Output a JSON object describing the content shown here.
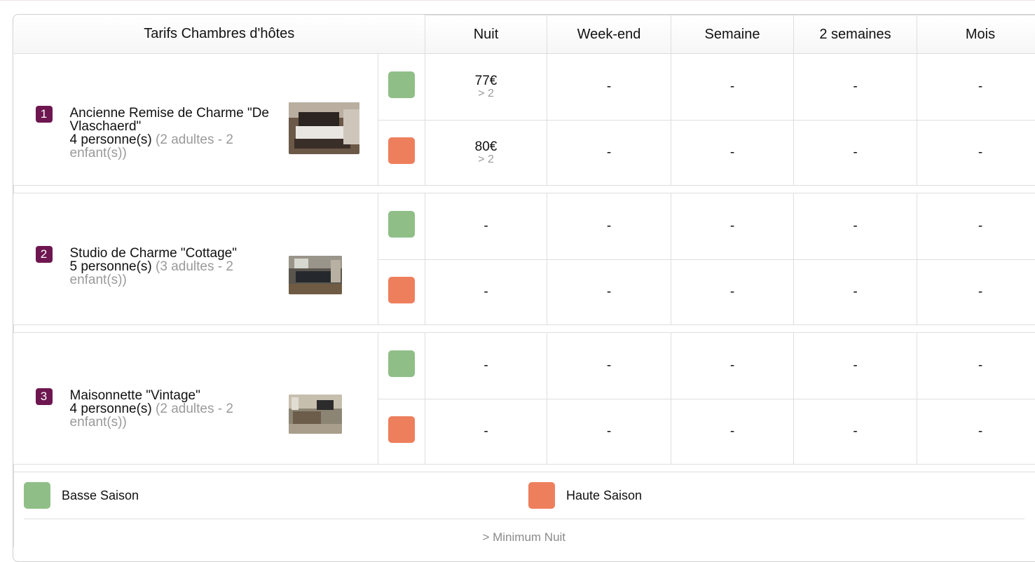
{
  "header": {
    "title": "Tarifs Chambres d'hôtes",
    "columns": [
      "Nuit",
      "Week-end",
      "Semaine",
      "2 semaines",
      "Mois"
    ]
  },
  "rooms": [
    {
      "number": "1",
      "name": "Ancienne Remise de Charme \"De Vlaschaerd\"",
      "persons": "4 personne(s)",
      "capacity": "(2 adultes - 2 enfant(s))",
      "rates": [
        {
          "season": "basse",
          "values": [
            "77€",
            "-",
            "-",
            "-",
            "-"
          ],
          "min_nights": "> 2"
        },
        {
          "season": "haute",
          "values": [
            "80€",
            "-",
            "-",
            "-",
            "-"
          ],
          "min_nights": "> 2"
        }
      ]
    },
    {
      "number": "2",
      "name": "Studio de Charme \"Cottage\"",
      "persons": "5 personne(s)",
      "capacity": "(3 adultes - 2 enfant(s))",
      "rates": [
        {
          "season": "basse",
          "values": [
            "-",
            "-",
            "-",
            "-",
            "-"
          ],
          "min_nights": ""
        },
        {
          "season": "haute",
          "values": [
            "-",
            "-",
            "-",
            "-",
            "-"
          ],
          "min_nights": ""
        }
      ]
    },
    {
      "number": "3",
      "name": "Maisonnette \"Vintage\"",
      "persons": "4 personne(s)",
      "capacity": "(2 adultes - 2 enfant(s))",
      "rates": [
        {
          "season": "basse",
          "values": [
            "-",
            "-",
            "-",
            "-",
            "-"
          ],
          "min_nights": ""
        },
        {
          "season": "haute",
          "values": [
            "-",
            "-",
            "-",
            "-",
            "-"
          ],
          "min_nights": ""
        }
      ]
    }
  ],
  "legend": {
    "low_season": "Basse Saison",
    "high_season": "Haute Saison",
    "note": "> Minimum Nuit"
  },
  "colors": {
    "low_season": "#8fbf87",
    "high_season": "#ee7f5d",
    "badge": "#6e1650"
  }
}
